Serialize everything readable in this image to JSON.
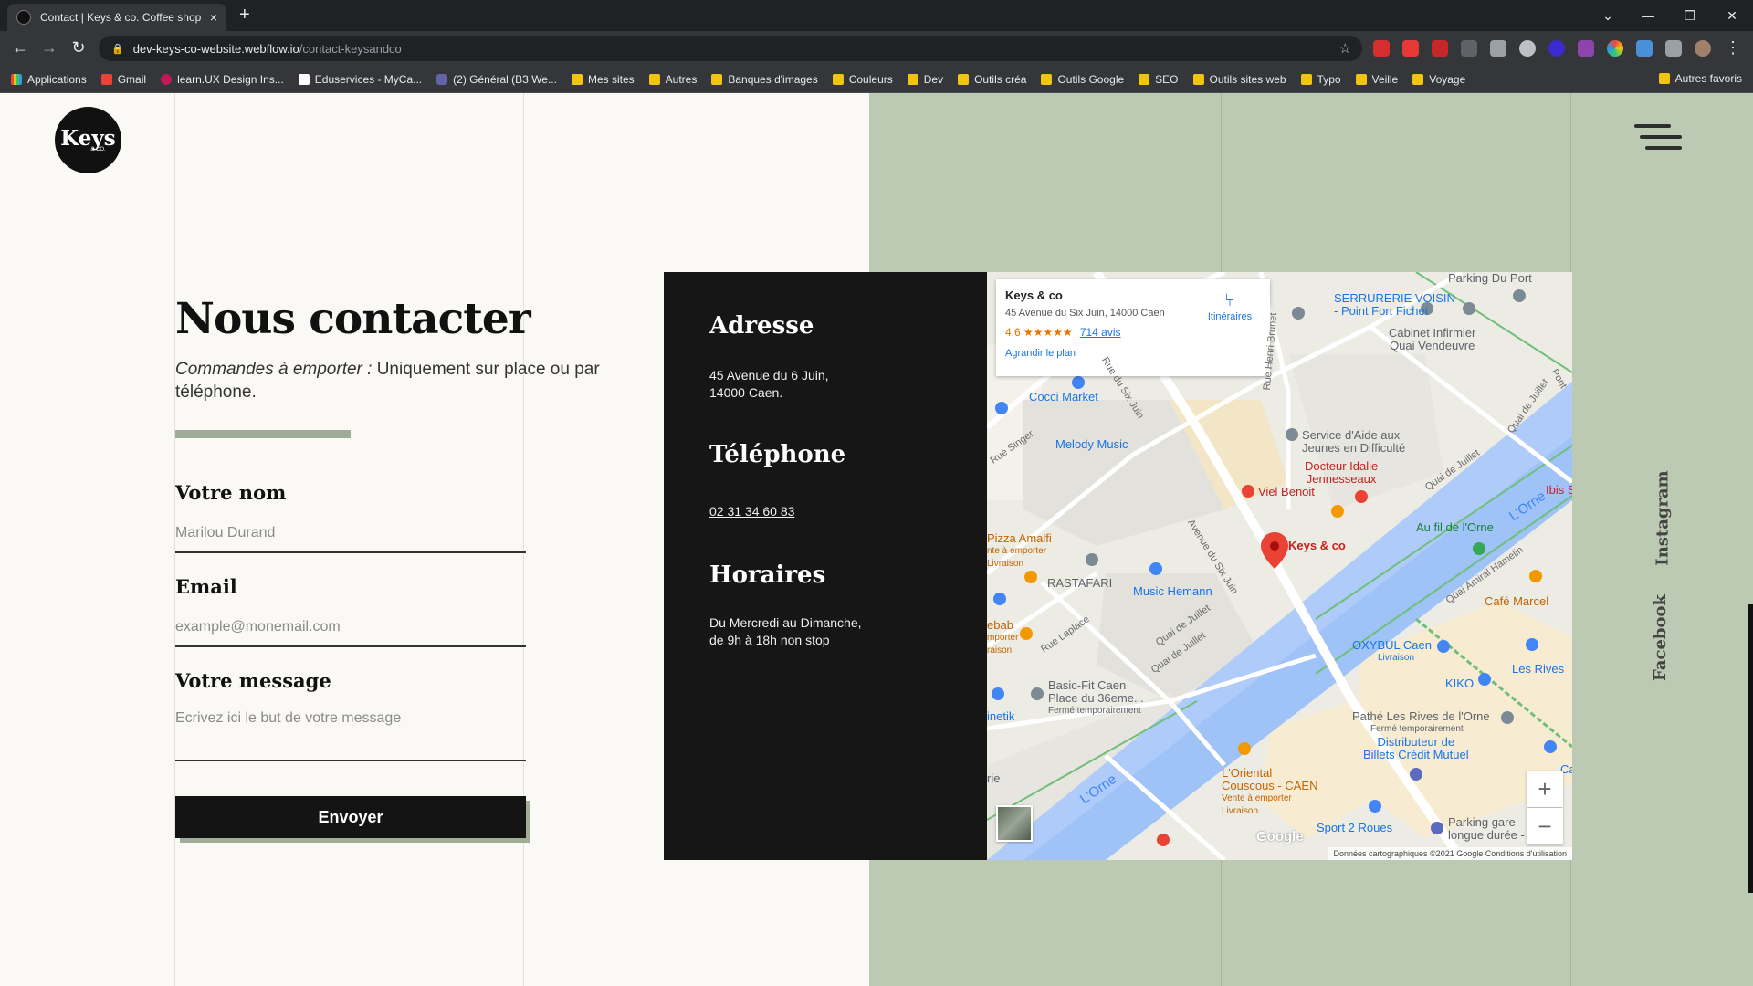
{
  "browser": {
    "tab_title": "Contact | Keys & co. Coffee shop",
    "tab_close": "×",
    "new_tab": "+",
    "url_host": "dev-keys-co-website.webflow.io",
    "url_path": "/contact-keysandco",
    "bookmarks": [
      "Applications",
      "Gmail",
      "learn.UX Design Ins...",
      "Eduservices - MyCa...",
      "(2) Général (B3 We...",
      "Mes sites",
      "Autres",
      "Banques d'images",
      "Couleurs",
      "Dev",
      "Outils créa",
      "Outils Google",
      "SEO",
      "Outils sites web",
      "Typo",
      "Veille",
      "Voyage"
    ],
    "bookmarks_more": "»",
    "other_bookmarks": "Autres favoris"
  },
  "site": {
    "logo_text": "Keys",
    "logo_sub": "& CO."
  },
  "contact": {
    "title": "Nous contacter",
    "subtitle_em": "Commandes à emporter :",
    "subtitle_rest": " Uniquement sur place ou par téléphone.",
    "form": {
      "name_label": "Votre nom",
      "name_placeholder": "Marilou Durand",
      "email_label": "Email",
      "email_placeholder": "example@monemail.com",
      "message_label": "Votre message",
      "message_placeholder": "Ecrivez ici le but de votre message",
      "submit_label": "Envoyer"
    }
  },
  "card": {
    "address_title": "Adresse",
    "address_line1": "45 Avenue du 6 Juin,",
    "address_line2": "14000 Caen.",
    "phone_title": "Téléphone",
    "phone": "02 31 34 60 83",
    "hours_title": "Horaires",
    "hours_line1": "Du Mercredi au Dimanche,",
    "hours_line2": "de 9h à 18h non stop"
  },
  "map": {
    "place_name": "Keys & co",
    "place_address": "45 Avenue du Six Juin, 14000 Caen",
    "rating": "4,6 ★★★★★",
    "reviews": "714 avis",
    "enlarge": "Agrandir le plan",
    "directions": "Itinéraires",
    "pin_label": "Keys & co",
    "labels": {
      "parking_port": "Parking Du Port",
      "serrurerie": "SERRURERIE VOISIN",
      "serrurerie2": "- Point Fort Fichet",
      "cabinet": "Cabinet Infirmier",
      "cabinet2": "Quai Vendeuvre",
      "cocci": "Cocci Market",
      "melody": "Melody Music",
      "service": "Service d'Aide aux",
      "service2": "Jeunes en Difficulté",
      "docteur": "Docteur Idalie",
      "docteur2": "Jennesseaux",
      "viel": "Viel Benoit",
      "ibis": "Ibis S",
      "aufil": "Au fil de l'Orne",
      "pizza": "Pizza Amalfi",
      "pizza_sub": "nte à emporter",
      "pizza_sub2": "Livraison",
      "rastafari": "RASTAFARI",
      "musichemann": "Music Hemann",
      "cafe": "Café Marcel",
      "kebab": "ebab",
      "kebab2": "mporter",
      "kebab3": "raison",
      "oxybul": "OXYBUL Caen",
      "oxybul_sub": "Livraison",
      "lesrives": "Les Rives",
      "kiko": "KIKO",
      "basicfit": "Basic-Fit Caen",
      "basicfit2": "Place du 36eme...",
      "basicfit_sub": "Fermé temporairement",
      "netik": "inetik",
      "pathe": "Pathé Les Rives de l'Orne",
      "pathe_sub": "Fermé temporairement",
      "distrib": "Distributeur de",
      "distrib2": "Billets Crédit Mutuel",
      "oriental": "L'Oriental",
      "oriental2": "Couscous - CAEN",
      "oriental_sub": "Vente à emporter",
      "oriental_sub2": "Livraison",
      "sport2": "Sport 2 Roues",
      "parkinggare": "Parking gare",
      "parkinggare2": "longue durée - EFFIA",
      "ca": "Ca",
      "rie": "rie",
      "orne1": "L'Orne",
      "orne2": "L'Orne",
      "quai_juillet": "Quai de Juillet",
      "quai_juillet2": "Quai de Juillet",
      "quai_juillet3": "Quai de Juillet",
      "quai_amiral": "Quai Amiral Hamelin",
      "ave_six_juin": "Avenue du Six Juin",
      "rue_six_juin": "Rue du Six Juin",
      "rue_singer": "Rue Singer",
      "rue_laplace": "Rue Laplace",
      "rue_brunet": "Rue Henri Brunet",
      "pont": "Pont",
      "quai_juillet4": "Quai de Juillet"
    },
    "google": "Google",
    "attribution": "Données cartographiques ©2021 Google    Conditions d'utilisation",
    "zoom_in": "+",
    "zoom_out": "−"
  },
  "social": {
    "instagram": "Instagram",
    "facebook": "Facebook"
  }
}
